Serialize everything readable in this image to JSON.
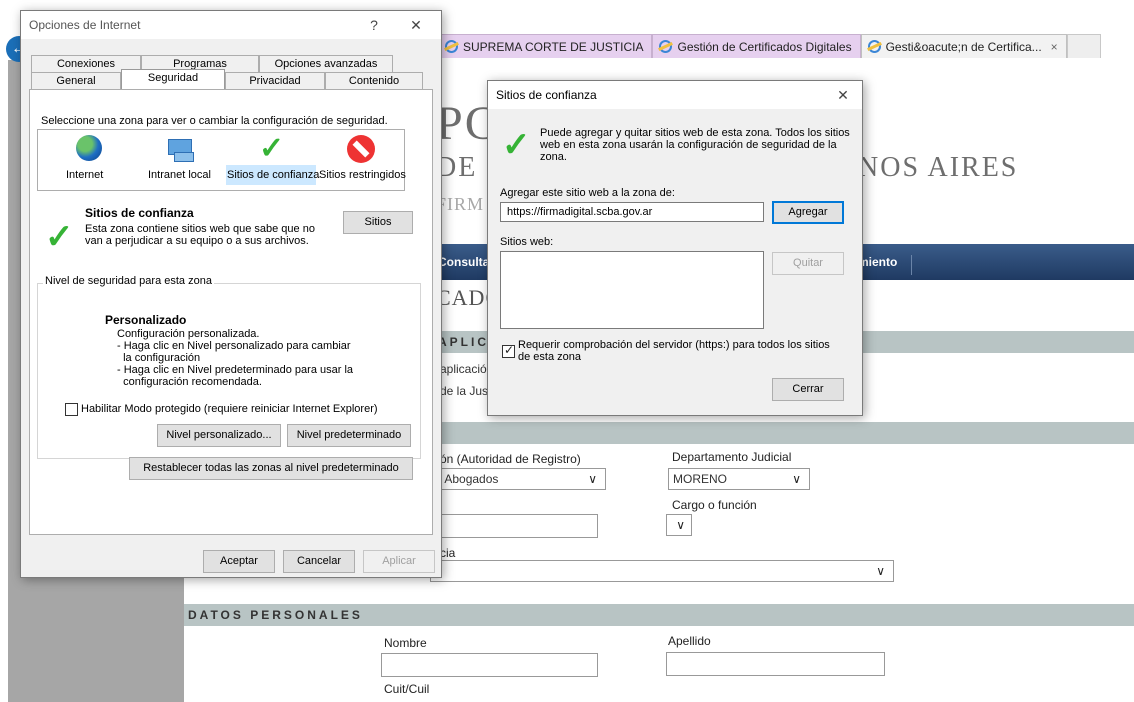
{
  "browser": {
    "tabs": [
      {
        "label": "SUPREMA CORTE DE JUSTICIA"
      },
      {
        "label": "Gestión de Certificados Digitales"
      },
      {
        "label": "Gesti&oacute;n de Certifica...",
        "close": "×"
      }
    ],
    "page": {
      "logo_p": "PC",
      "logo_de": "DE",
      "logo_nos": "NOS AIRES",
      "logo_firm": "FIRM",
      "nav_consulta": "Consulta",
      "nav_miento": "miento",
      "heading": "CADO",
      "bar_aplicacion": "APLICACI",
      "aplicacion_text": "aplicació",
      "justicia_text": "de la Justi",
      "autoridad_label": "ón (Autoridad de Registro)",
      "autoridad_value": "e Abogados",
      "departamento_label": "Departamento Judicial",
      "departamento_value": "MORENO",
      "cargo_label": "Cargo o función",
      "cia_label": "cia",
      "datos_personales": "DATOS PERSONALES",
      "nombre_label": "Nombre",
      "apellido_label": "Apellido",
      "cuit_label": "Cuit/Cuil"
    }
  },
  "internet_options": {
    "title": "Opciones de Internet",
    "help": "?",
    "close": "✕",
    "tabs_row1": [
      "Conexiones",
      "Programas",
      "Opciones avanzadas"
    ],
    "tabs_row2": [
      "General",
      "Seguridad",
      "Privacidad",
      "Contenido"
    ],
    "zone_prompt": "Seleccione una zona para ver o cambiar la configuración de seguridad.",
    "zones": [
      "Internet",
      "Intranet local",
      "Sitios de confianza",
      "Sitios restringidos"
    ],
    "zone_title": "Sitios de confianza",
    "zone_desc_1": "Esta zona contiene sitios web que sabe que no",
    "zone_desc_2": "van a perjudicar a su equipo o a sus archivos.",
    "sitios_button": "Sitios",
    "level_legend": "Nivel de seguridad para esta zona",
    "custom_title": "Personalizado",
    "custom_lines": [
      "Configuración personalizada.",
      "- Haga clic en Nivel personalizado para cambiar",
      "  la configuración",
      "- Haga clic en Nivel predeterminado para usar la",
      "  configuración recomendada."
    ],
    "protected_mode": "Habilitar Modo protegido (requiere reiniciar Internet Explorer)",
    "nivel_personalizado": "Nivel personalizado...",
    "nivel_predeterminado": "Nivel predeterminado",
    "restablecer": "Restablecer todas las zonas al nivel predeterminado",
    "aceptar": "Aceptar",
    "cancelar": "Cancelar",
    "aplicar": "Aplicar"
  },
  "trusted_sites": {
    "title": "Sitios de confianza",
    "close": "✕",
    "info_1": "Puede agregar y quitar sitios web de esta zona. Todos los sitios",
    "info_2": "web en esta zona usarán la configuración de seguridad de la",
    "info_3": "zona.",
    "add_label": "Agregar este sitio web a la zona de:",
    "url_value": "https://firmadigital.scba.gov.ar",
    "agregar": "Agregar",
    "sites_label": "Sitios web:",
    "quitar": "Quitar",
    "require_https_1": "Requerir comprobación del servidor (https:) para todos los sitios",
    "require_https_2": "de esta zona",
    "cerrar": "Cerrar"
  }
}
